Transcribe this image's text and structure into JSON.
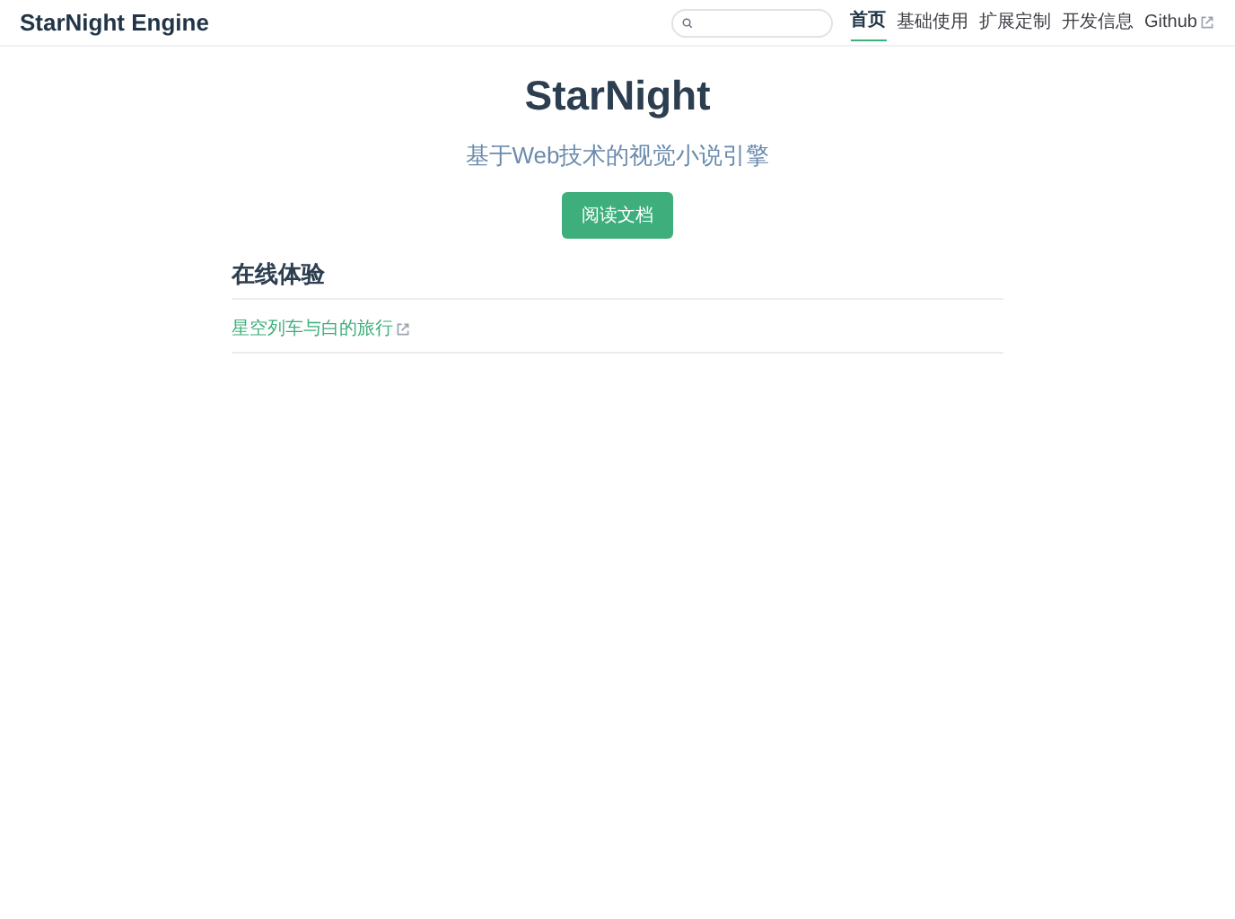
{
  "site_title": "StarNight Engine",
  "nav": [
    {
      "label": "首页",
      "selected": true,
      "external": false
    },
    {
      "label": "基础使用",
      "selected": false,
      "external": false
    },
    {
      "label": "扩展定制",
      "selected": false,
      "external": false
    },
    {
      "label": "开发信息",
      "selected": false,
      "external": false
    },
    {
      "label": "Github",
      "selected": false,
      "external": true
    }
  ],
  "hero": {
    "title": "StarNight",
    "tagline": "基于Web技术的视觉小说引擎",
    "action": "阅读文档"
  },
  "section": {
    "heading": "在线体验",
    "links": [
      {
        "label": "星空列车与白的旅行",
        "external": true
      }
    ]
  }
}
